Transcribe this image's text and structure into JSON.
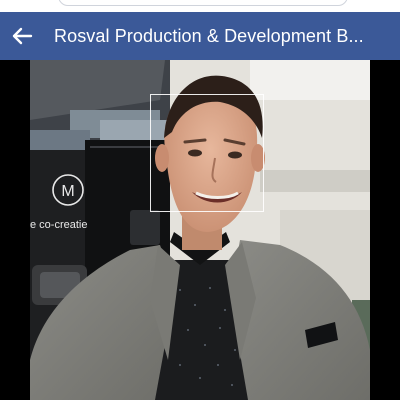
{
  "app_bar": {
    "back_icon": "arrow-left-icon",
    "title": "Rosval Production & Development B..."
  },
  "photo": {
    "booth_sign_letter": "M",
    "booth_text": "e co-creatie",
    "face_tag": true
  },
  "colors": {
    "app_bar_background": "#3b5998",
    "photo_background": "#000000"
  }
}
